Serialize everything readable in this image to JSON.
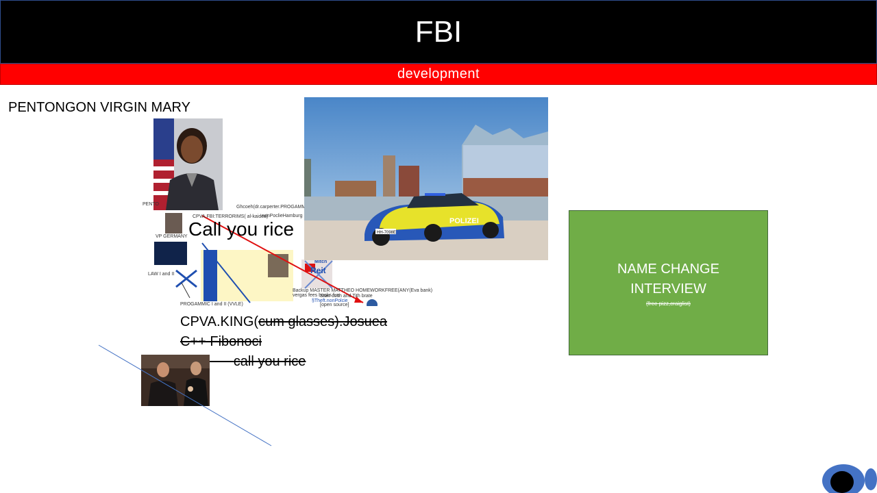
{
  "slide": {
    "title": "FBI",
    "subtitle": "development",
    "heading": "PENTONGON VIRGIN MARY",
    "call_you_rice_big": "Call you rice",
    "police_label": "POLIZEI",
    "plate": "HH-7098E",
    "collage": {
      "labels": {
        "pento": "PENTO",
        "ghcoeh": "Ghcoeh(dr.carperter.PROGAMMIN III",
        "cpva": "CPVA.FBI:TERRORIMS( al-kaidea)",
        "nonpocile": "nonPoclieHamburg",
        "vp": "VP GERMANY",
        "law": "LAW I and II",
        "programmic": "PROGAMMIC I and II (VVLE)",
        "backup": "Backup MASTER MATTHEO HOMEWORKFREE(ANY(Eva bank)",
        "vergas": "vergas fees books fun",
        "stars": "Starr cosh and Tith brate",
        "theft": "§Theft.nonPolcie",
        "open": "[open source]",
        "mitch": "Mitch",
        "reit": "Reit"
      }
    },
    "green_box": {
      "line1": "NAME CHANGE",
      "line2": "INTERVIEW",
      "note": "(free pizz,craiglist)"
    },
    "code_lines": {
      "l1_prefix": "CPVA.KING(",
      "l1_strike": "cum glasses).Josuea",
      "l2": "C++ Fibonoci",
      "l3_lead": "              ",
      "l3": "call you rice"
    }
  },
  "colors": {
    "title_bg": "#000000",
    "sub_bg": "#ff0000",
    "green": "#70ad47",
    "accent_blue": "#4472c4"
  }
}
